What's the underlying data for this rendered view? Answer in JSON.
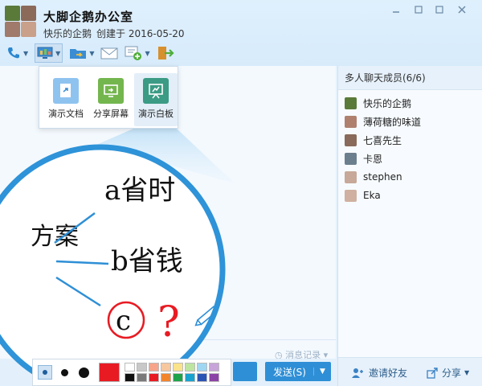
{
  "window": {
    "title": "大脚企鹅办公室",
    "creator": "快乐的企鹅",
    "created_text": "创建于 2016-05-20"
  },
  "popup": {
    "items": [
      {
        "label": "演示文档",
        "icon": "document-present-icon",
        "color": "#8fc3ef"
      },
      {
        "label": "分享屏幕",
        "icon": "screen-share-icon",
        "color": "#74b64e"
      },
      {
        "label": "演示白板",
        "icon": "whiteboard-icon",
        "color": "#3b9b84"
      }
    ]
  },
  "chat": {
    "history_label": "消息记录"
  },
  "members": {
    "header": "多人聊天成员(6/6)",
    "list": [
      {
        "name": "快乐的企鹅"
      },
      {
        "name": "薄荷糖的味道"
      },
      {
        "name": "七喜先生"
      },
      {
        "name": "卡恩"
      },
      {
        "name": "stephen"
      },
      {
        "name": "Eka"
      }
    ],
    "invite_label": "邀请好友",
    "share_label": "分享"
  },
  "composer": {
    "send_label": "发送(S)"
  },
  "whiteboard": {
    "handwriting": {
      "left": "方案",
      "a": "a省时",
      "b": "b省钱",
      "c": "c",
      "question": "?"
    },
    "palette": {
      "current_color": "#e81b23",
      "swatches": [
        "#ffffff",
        "#c8c8c8",
        "#f7a48a",
        "#f7c79e",
        "#f9e38b",
        "#bde5a0",
        "#9fd6f2",
        "#c7a4d9",
        "#111111",
        "#7a7a7a",
        "#e81b23",
        "#f2852b",
        "#1fa34a",
        "#18a2cf",
        "#2b55b5",
        "#8c43a6"
      ]
    }
  },
  "colors": {
    "accent": "#2e8fd6",
    "zoom_ring": "#2e93d8"
  }
}
